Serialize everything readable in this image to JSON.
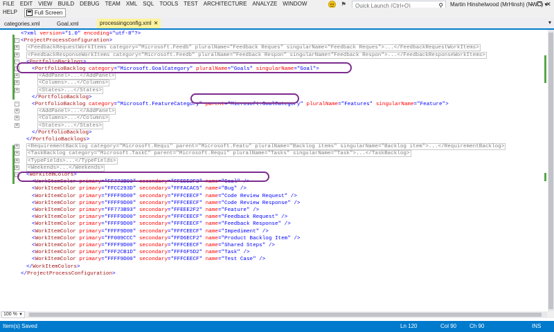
{
  "menu": [
    "FILE",
    "EDIT",
    "VIEW",
    "BUILD",
    "DEBUG",
    "TEAM",
    "XML",
    "SQL",
    "TOOLS",
    "TEST",
    "ARCHITECTURE",
    "ANALYZE",
    "WINDOW"
  ],
  "help_label": "HELP",
  "fullscreen_label": "Full Screen",
  "quick_launch_placeholder": "Quick Launch (Ctrl+Q)",
  "user_name": "Martin Hinshelwood (MrHinsh) (NWC) ▾",
  "tabs": [
    {
      "label": "categories.xml",
      "active": false
    },
    {
      "label": "Goal.xml",
      "active": false
    },
    {
      "label": "processingconfig.xml",
      "active": true
    }
  ],
  "code_lines": [
    "<?xml version=\"1.0\" encoding=\"utf-8\"?>",
    "<ProjectProcessConfiguration>",
    "<FeedbackRequestWorkItems category=\"Microsoft.Feedb\" pluralName=\"Feedback Reques\" singularName=\"Feedback Reques\">...</FeedbackRequestWorkItems>",
    "<FeedbackResponseWorkItems category=\"Microsoft.Feedb\" pluralName=\"Feedback Respon\" singularName=\"Feedback Respon\">...</FeedbackResponseWorkItems>",
    "<PortfolioBacklogs>",
    "<PortfolioBacklog category=\"Microsoft.GoalCategory\" pluralName=\"Goals\" singularName=\"Goal\">",
    "<AddPanel>...</AddPanel>",
    "<Columns>...</Columns>",
    "<States>...</States>",
    "</PortfolioBacklog>",
    "<PortfolioBacklog category=\"Microsoft.FeatureCategory\" parent=\"Microsoft.GoalCategory\" pluralName=\"Features\" singularName=\"Feature\">",
    "<AddPanel>...</AddPanel>",
    "<Columns>...</Columns>",
    "<States>...</States>",
    "</PortfolioBacklog>",
    "</PortfolioBacklogs>",
    "<RequirementBacklog category=\"Microsoft.Requi\" parent=\"Microsoft.Featu\" pluralName=\"Backlog items\" singularName=\"Backlog item\">...</RequirementBacklog>",
    "<TaskBacklog category=\"Microsoft.TaskC\" parent=\"Microsoft.Requi\" pluralName=\"Tasks\" singularName=\"Task\">...</TaskBacklog>",
    "<TypeFields>...</TypeFields>",
    "<Weekends>...</Weekends>",
    "<WorkItemColors>",
    "<WorkItemColor primary=\"FF773B93\" secondary=\"FFEEE2F2\" name=\"Goal\" />",
    "<WorkItemColor primary=\"FFCC293D\" secondary=\"FFFACAC5\" name=\"Bug\" />",
    "<WorkItemColor primary=\"FFFF9D00\" secondary=\"FFFCEECF\" name=\"Code Review Request\" />",
    "<WorkItemColor primary=\"FFFF9D00\" secondary=\"FFFCEECF\" name=\"Code Review Response\" />",
    "<WorkItemColor primary=\"FF773B93\" secondary=\"FFEEE2F2\" name=\"Feature\" />",
    "<WorkItemColor primary=\"FFFF9D00\" secondary=\"FFFCEECF\" name=\"Feedback Request\" />",
    "<WorkItemColor primary=\"FFFF9D00\" secondary=\"FFFCEECF\" name=\"Feedback Response\" />",
    "<WorkItemColor primary=\"FFFF9D00\" secondary=\"FFFCEECF\" name=\"Impediment\" />",
    "<WorkItemColor primary=\"FF009CCC\" secondary=\"FFD6ECF2\" name=\"Product Backlog Item\" />",
    "<WorkItemColor primary=\"FFFF9D00\" secondary=\"FFFCEECF\" name=\"Shared Steps\" />",
    "<WorkItemColor primary=\"FFF2CB1D\" secondary=\"FFF6F5D2\" name=\"Task\" />",
    "<WorkItemColor primary=\"FFFF9D00\" secondary=\"FFFCEECF\" name=\"Test Case\" />",
    "</WorkItemColors>",
    "</ProjectProcessConfiguration>"
  ],
  "zoom": "100 %",
  "status": {
    "message": "Item(s) Saved",
    "line": "Ln 120",
    "col": "Col 90",
    "ch": "Ch 90",
    "mode": "INS"
  },
  "colors": {
    "accent": "#007acc",
    "highlight_oval": "#7b2a8c",
    "active_tab": "#fff29d",
    "change_bar": "#57a64a"
  }
}
